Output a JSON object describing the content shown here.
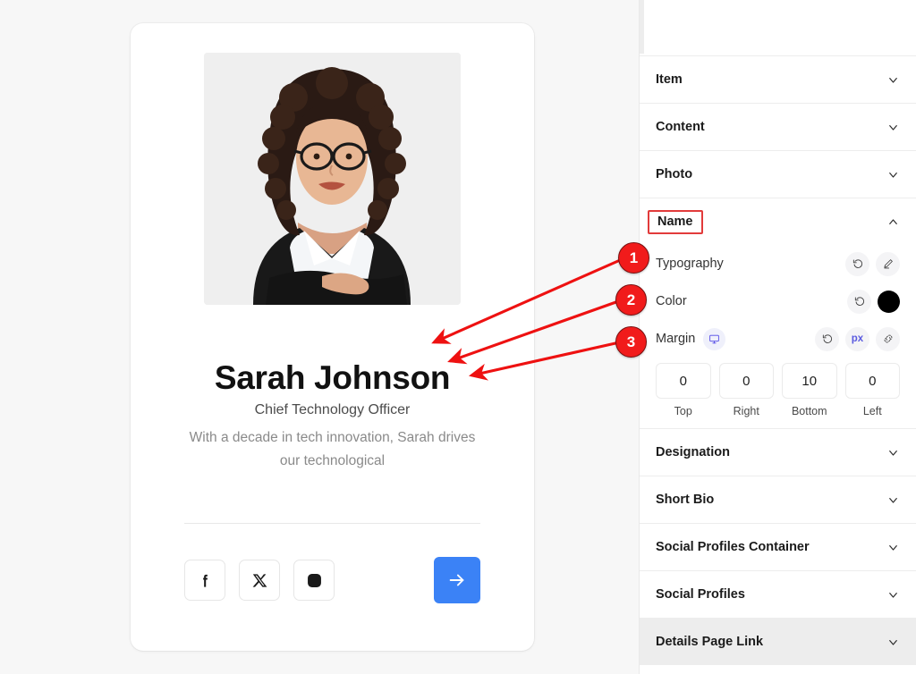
{
  "card": {
    "photo_alt": "portrait-photo",
    "name": "Sarah Johnson",
    "role": "Chief Technology Officer",
    "bio": "With a decade in tech innovation, Sarah drives our technological",
    "social": [
      {
        "icon": "facebook-icon",
        "name": "facebook"
      },
      {
        "icon": "x-twitter-icon",
        "name": "x-twitter"
      },
      {
        "icon": "instagram-icon",
        "name": "instagram"
      }
    ],
    "cta_icon": "arrow-right-icon",
    "cta_color": "#3b82f6"
  },
  "panel": {
    "sections_top": [
      {
        "title": "Item",
        "state": "collapsed",
        "chevron": "chevron-down-icon"
      },
      {
        "title": "Content",
        "state": "collapsed",
        "chevron": "chevron-down-icon"
      },
      {
        "title": "Photo",
        "state": "collapsed",
        "chevron": "chevron-down-icon"
      }
    ],
    "active_section": {
      "title": "Name",
      "state": "expanded",
      "chevron": "chevron-up-icon",
      "highlight_color": "#e23b3b"
    },
    "controls": {
      "typography": {
        "label": "Typography",
        "reset_icon": "reset-icon",
        "edit_icon": "pencil-edit-icon"
      },
      "color": {
        "label": "Color",
        "reset_icon": "reset-icon",
        "swatch_color": "#000000"
      },
      "margin": {
        "label": "Margin",
        "device_icon": "desktop-monitor-icon",
        "reset_icon": "reset-icon",
        "unit": "px",
        "link_icon": "link-values-icon",
        "fields": [
          {
            "value": "0",
            "label": "Top"
          },
          {
            "value": "0",
            "label": "Right"
          },
          {
            "value": "10",
            "label": "Bottom"
          },
          {
            "value": "0",
            "label": "Left"
          }
        ]
      }
    },
    "sections_bottom": [
      {
        "title": "Designation",
        "state": "collapsed",
        "chevron": "chevron-down-icon",
        "hovered": false
      },
      {
        "title": "Short Bio",
        "state": "collapsed",
        "chevron": "chevron-down-icon",
        "hovered": false
      },
      {
        "title": "Social Profiles Container",
        "state": "collapsed",
        "chevron": "chevron-down-icon",
        "hovered": false
      },
      {
        "title": "Social Profiles",
        "state": "collapsed",
        "chevron": "chevron-down-icon",
        "hovered": false
      },
      {
        "title": "Details Page Link",
        "state": "collapsed",
        "chevron": "chevron-down-icon",
        "hovered": true
      }
    ]
  },
  "annotations": {
    "badges": [
      {
        "number": "1",
        "points_to": "Typography"
      },
      {
        "number": "2",
        "points_to": "Color"
      },
      {
        "number": "3",
        "points_to": "Margin"
      }
    ],
    "arrow_color": "#ee1111"
  }
}
